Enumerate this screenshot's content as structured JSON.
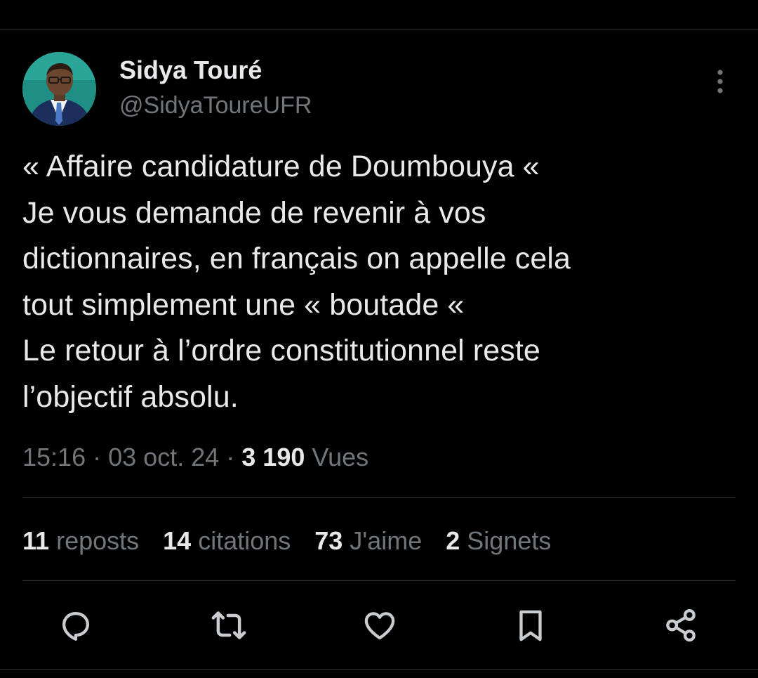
{
  "author": {
    "display_name": "Sidya Touré",
    "handle": "@SidyaToureUFR"
  },
  "tweet": {
    "text": "« Affaire candidature de Doumbouya «\nJe vous demande de revenir à vos\ndictionnaires, en français on appelle cela\ntout simplement une « boutade «\nLe retour à l’ordre constitutionnel reste\nl’objectif absolu.",
    "time": "15:16",
    "separator": "·",
    "date": "03 oct. 24",
    "views_count": "3 190",
    "views_label": "Vues"
  },
  "stats": [
    {
      "count": "11",
      "label": "reposts"
    },
    {
      "count": "14",
      "label": "citations"
    },
    {
      "count": "73",
      "label": "J'aime"
    },
    {
      "count": "2",
      "label": "Signets"
    }
  ],
  "actions": [
    {
      "icon": "reply-icon"
    },
    {
      "icon": "repost-icon"
    },
    {
      "icon": "like-icon"
    },
    {
      "icon": "bookmark-icon"
    },
    {
      "icon": "share-icon"
    }
  ],
  "colors": {
    "background": "#000000",
    "text_primary": "#e7e9ea",
    "text_secondary": "#71767b",
    "divider": "#2f3336",
    "icon": "#c9ccd0"
  }
}
